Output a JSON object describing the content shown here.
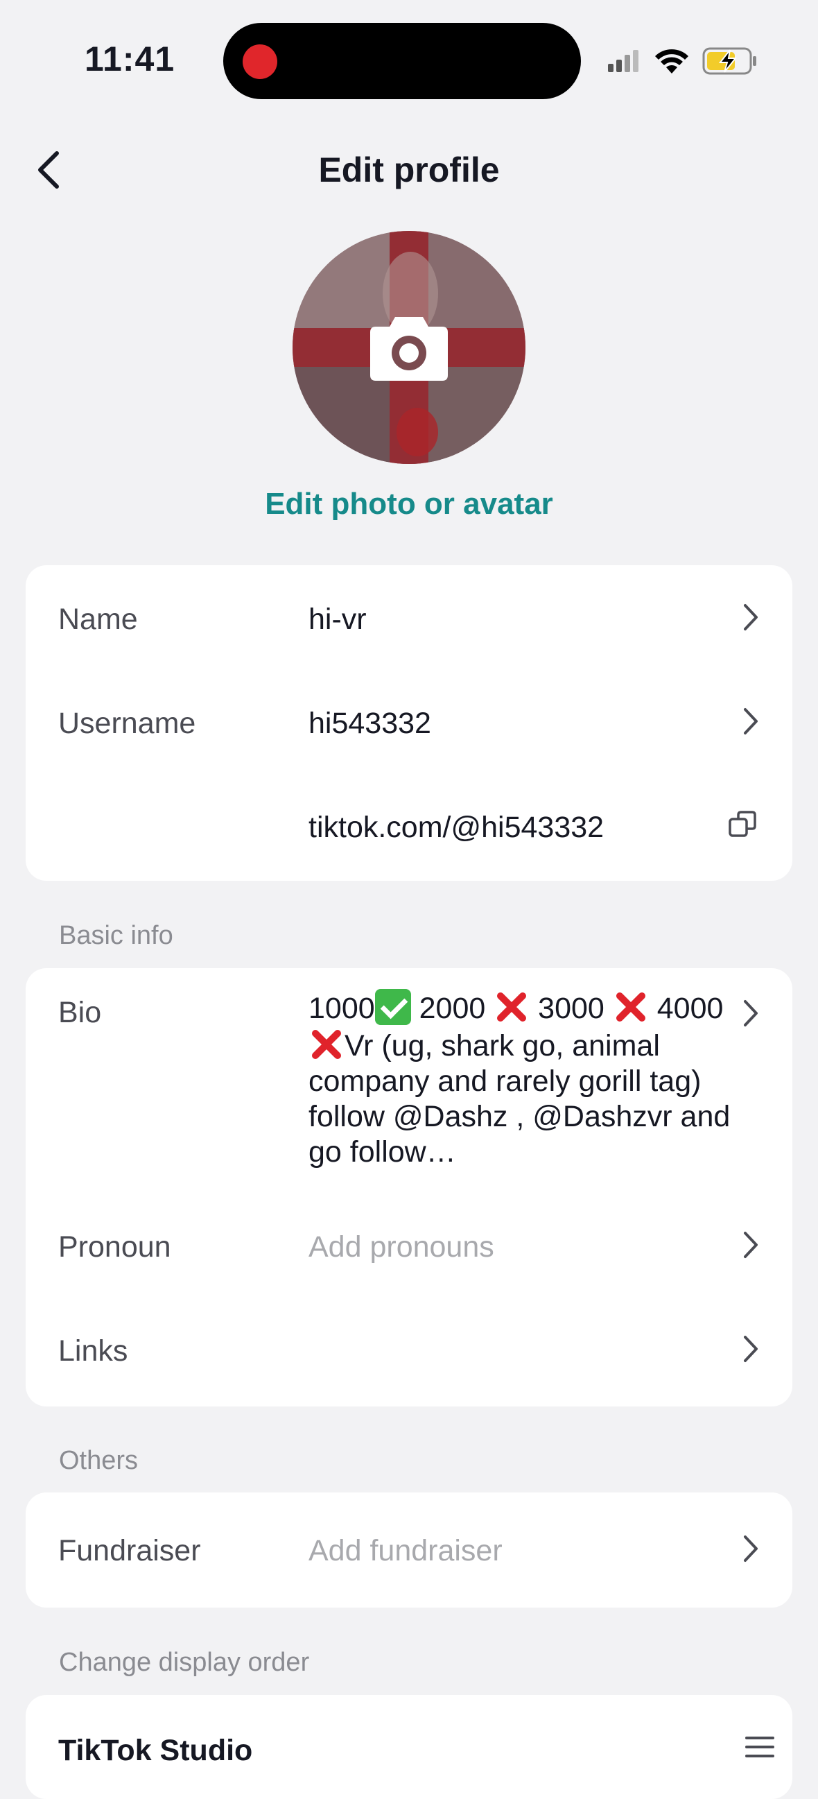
{
  "status_bar": {
    "time": "11:41",
    "icons": [
      "recording-indicator",
      "signal-icon",
      "wifi-icon",
      "battery-charging-icon"
    ]
  },
  "header": {
    "title": "Edit profile",
    "back_icon": "chevron-left-icon"
  },
  "avatar": {
    "edit_label": "Edit photo or avatar",
    "camera_icon": "camera-icon"
  },
  "profile_card": {
    "name_label": "Name",
    "name_value": "hi-vr",
    "username_label": "Username",
    "username_value": "hi543332",
    "link_value": "tiktok.com/@hi543332",
    "copy_icon": "copy-icon"
  },
  "basic_info": {
    "section_title": "Basic info",
    "bio_label": "Bio",
    "bio_seg1": "1000",
    "bio_seg2": " 2000 ",
    "bio_seg3": " 3000 ",
    "bio_seg4": "4000",
    "bio_seg5": "Vr (ug, shark go, animal company and rarely gorill tag) follow @Dashz , @Dashzvr  and go follow…",
    "pronoun_label": "Pronoun",
    "pronoun_placeholder": "Add pronouns",
    "links_label": "Links"
  },
  "others": {
    "section_title": "Others",
    "fundraiser_label": "Fundraiser",
    "fundraiser_placeholder": "Add fundraiser"
  },
  "display_order": {
    "section_title": "Change display order",
    "item_label": "TikTok Studio",
    "handle_icon": "drag-handle-icon"
  },
  "colors": {
    "accent": "#168a8a",
    "background": "#f2f2f4",
    "card": "#ffffff",
    "recording": "#e0262b"
  }
}
